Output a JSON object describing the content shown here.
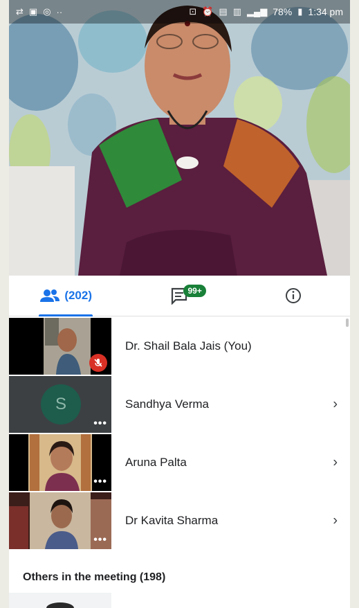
{
  "status_bar": {
    "battery": "78%",
    "time": "1:34 pm"
  },
  "tabs": {
    "people_count": "(202)",
    "chat_badge": "99+"
  },
  "participants": [
    {
      "name": "Dr. Shail Bala Jais (You)",
      "muted": true
    },
    {
      "name": "Sandhya Verma",
      "initial": "S"
    },
    {
      "name": "Aruna Palta"
    },
    {
      "name": "Dr Kavita Sharma"
    }
  ],
  "others_header": "Others in the meeting (198)",
  "colors": {
    "accent": "#1a73e8",
    "badge": "#188038",
    "muted": "#d93025"
  }
}
